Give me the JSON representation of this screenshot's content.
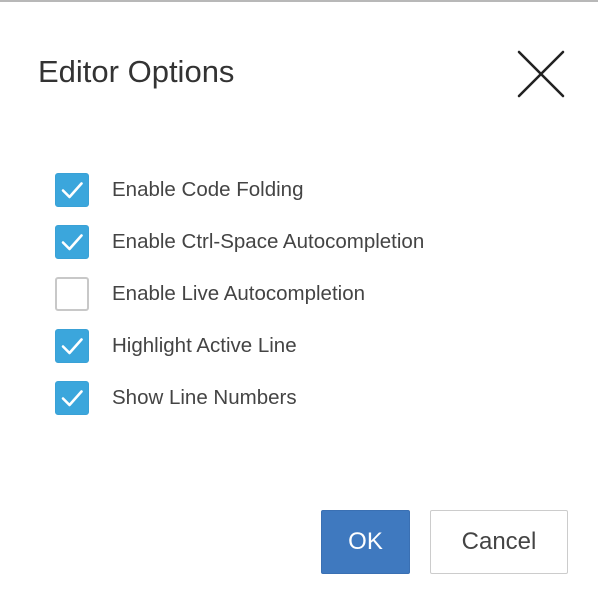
{
  "dialog": {
    "title": "Editor Options",
    "close_icon": "close-icon",
    "options": [
      {
        "label": "Enable Code Folding",
        "checked": true
      },
      {
        "label": "Enable Ctrl-Space Autocompletion",
        "checked": true
      },
      {
        "label": "Enable Live Autocompletion",
        "checked": false
      },
      {
        "label": "Highlight Active Line",
        "checked": true
      },
      {
        "label": "Show Line Numbers",
        "checked": true
      }
    ],
    "ok_label": "OK",
    "cancel_label": "Cancel"
  },
  "colors": {
    "checkbox_checked": "#3ba6dc",
    "ok_button": "#3f79bf",
    "title_text": "#333333"
  }
}
